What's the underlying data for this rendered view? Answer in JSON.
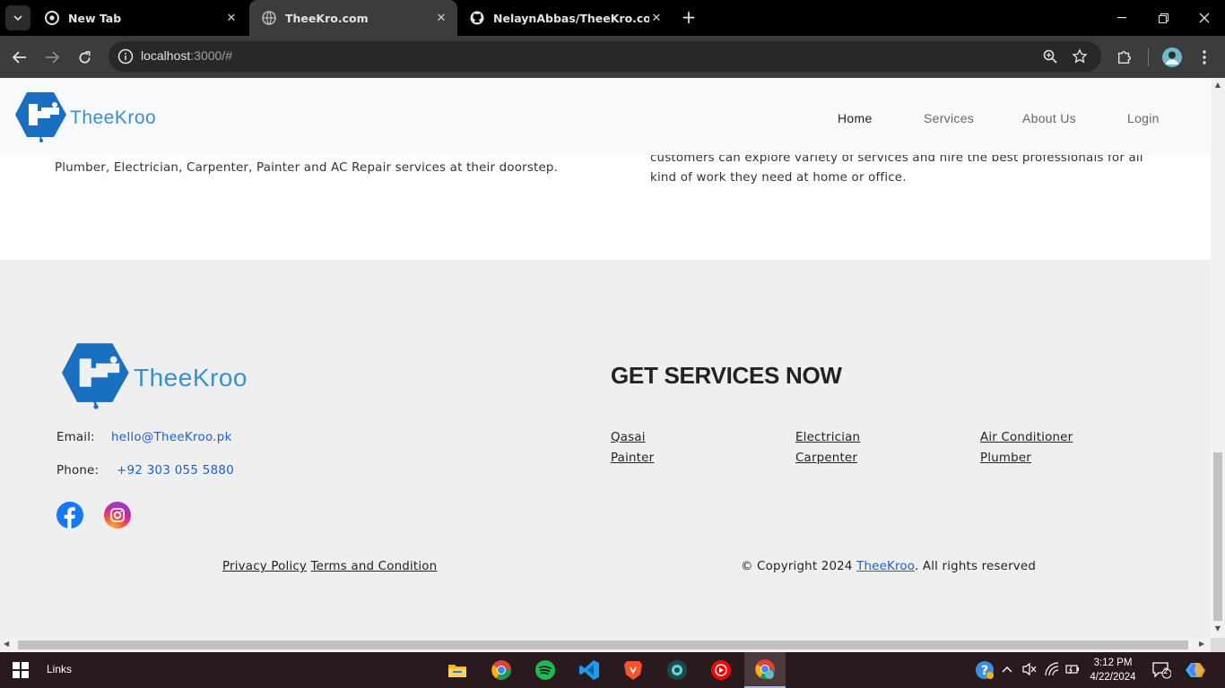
{
  "browser": {
    "tabs": [
      {
        "title": "New Tab",
        "active": false
      },
      {
        "title": "TheeKro.com",
        "active": true
      },
      {
        "title": "NelaynAbbas/TheeKro.com: Th",
        "active": false
      }
    ],
    "url_host": "localhost",
    "url_rest": ":3000/#"
  },
  "nav": {
    "logo_text": "TheeKroo",
    "links": [
      "Home",
      "Services",
      "About Us",
      "Login"
    ]
  },
  "about": {
    "left_text": "Plumber, Electrician, Carpenter, Painter and AC Repair services at their doorstep.",
    "right_text": "customers can explore variety of services and hire the best professionals for all kind of work they need at home or office."
  },
  "footer": {
    "logo_text": "TheeKroo",
    "email_label": "Email:",
    "email_value": "hello@TheeKroo.pk",
    "phone_label": "Phone:",
    "phone_value": "+92 303 055 5880",
    "heading": "GET SERVICES NOW",
    "services": [
      "Qasai",
      "Painter",
      "Electrician",
      "Carpenter",
      "Air Conditioner",
      "Plumber"
    ],
    "privacy": "Privacy Policy",
    "terms": "Terms and Condition",
    "copyright_prefix": "© Copyright 2024 ",
    "copyright_brand": "TheeKroo",
    "copyright_suffix": ". All rights reserved"
  },
  "taskbar": {
    "links_label": "Links",
    "time": "3:12 PM",
    "date": "4/22/2024",
    "notification_count": "2"
  },
  "colors": {
    "brand_blue": "#3a8fcd",
    "link_blue": "#1a5fd6",
    "footer_bg": "#efefef"
  }
}
